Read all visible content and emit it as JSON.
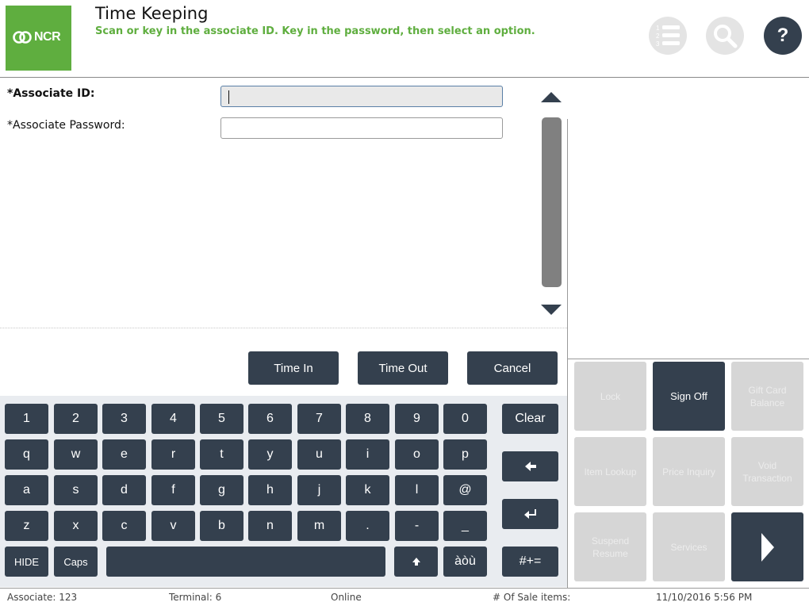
{
  "header": {
    "logo_text": "NCR",
    "title": "Time Keeping",
    "subtitle": "Scan or key in the associate ID. Key in the password, then select an option.",
    "help_label": "?",
    "icons": [
      "numbered-list-icon",
      "search-icon",
      "help-icon"
    ]
  },
  "form": {
    "associate_id_label": "*Associate ID:",
    "associate_id_value": "",
    "password_label": "*Associate Password:",
    "password_value": ""
  },
  "actions": {
    "time_in": "Time In",
    "time_out": "Time Out",
    "cancel": "Cancel"
  },
  "keyboard": {
    "row1": [
      "1",
      "2",
      "3",
      "4",
      "5",
      "6",
      "7",
      "8",
      "9",
      "0"
    ],
    "row2": [
      "q",
      "w",
      "e",
      "r",
      "t",
      "y",
      "u",
      "i",
      "o",
      "p"
    ],
    "row3": [
      "a",
      "s",
      "d",
      "f",
      "g",
      "h",
      "j",
      "k",
      "l",
      "@"
    ],
    "row4": [
      "z",
      "x",
      "c",
      "v",
      "b",
      "n",
      "m",
      ".",
      "-",
      "_"
    ],
    "hide": "HIDE",
    "caps": "Caps",
    "accents": "àòù",
    "clear": "Clear",
    "symbols": "#+="
  },
  "functions": {
    "lock": "Lock",
    "sign_off": "Sign Off",
    "gift_card_balance": "Gift Card Balance",
    "item_lookup": "Item Lookup",
    "price_inquiry": "Price Inquiry",
    "void_transaction": "Void Transaction",
    "suspend_resume": "Suspend Resume",
    "services": "Services"
  },
  "status": {
    "associate": "Associate: 123",
    "terminal": "Terminal: 6",
    "connection": "Online",
    "sale_items": "# Of Sale items:",
    "datetime": "11/10/2016 5:56 PM"
  },
  "colors": {
    "brand_green": "#5fae3f",
    "button_dark": "#34404e",
    "disabled": "#d6d6d6"
  }
}
